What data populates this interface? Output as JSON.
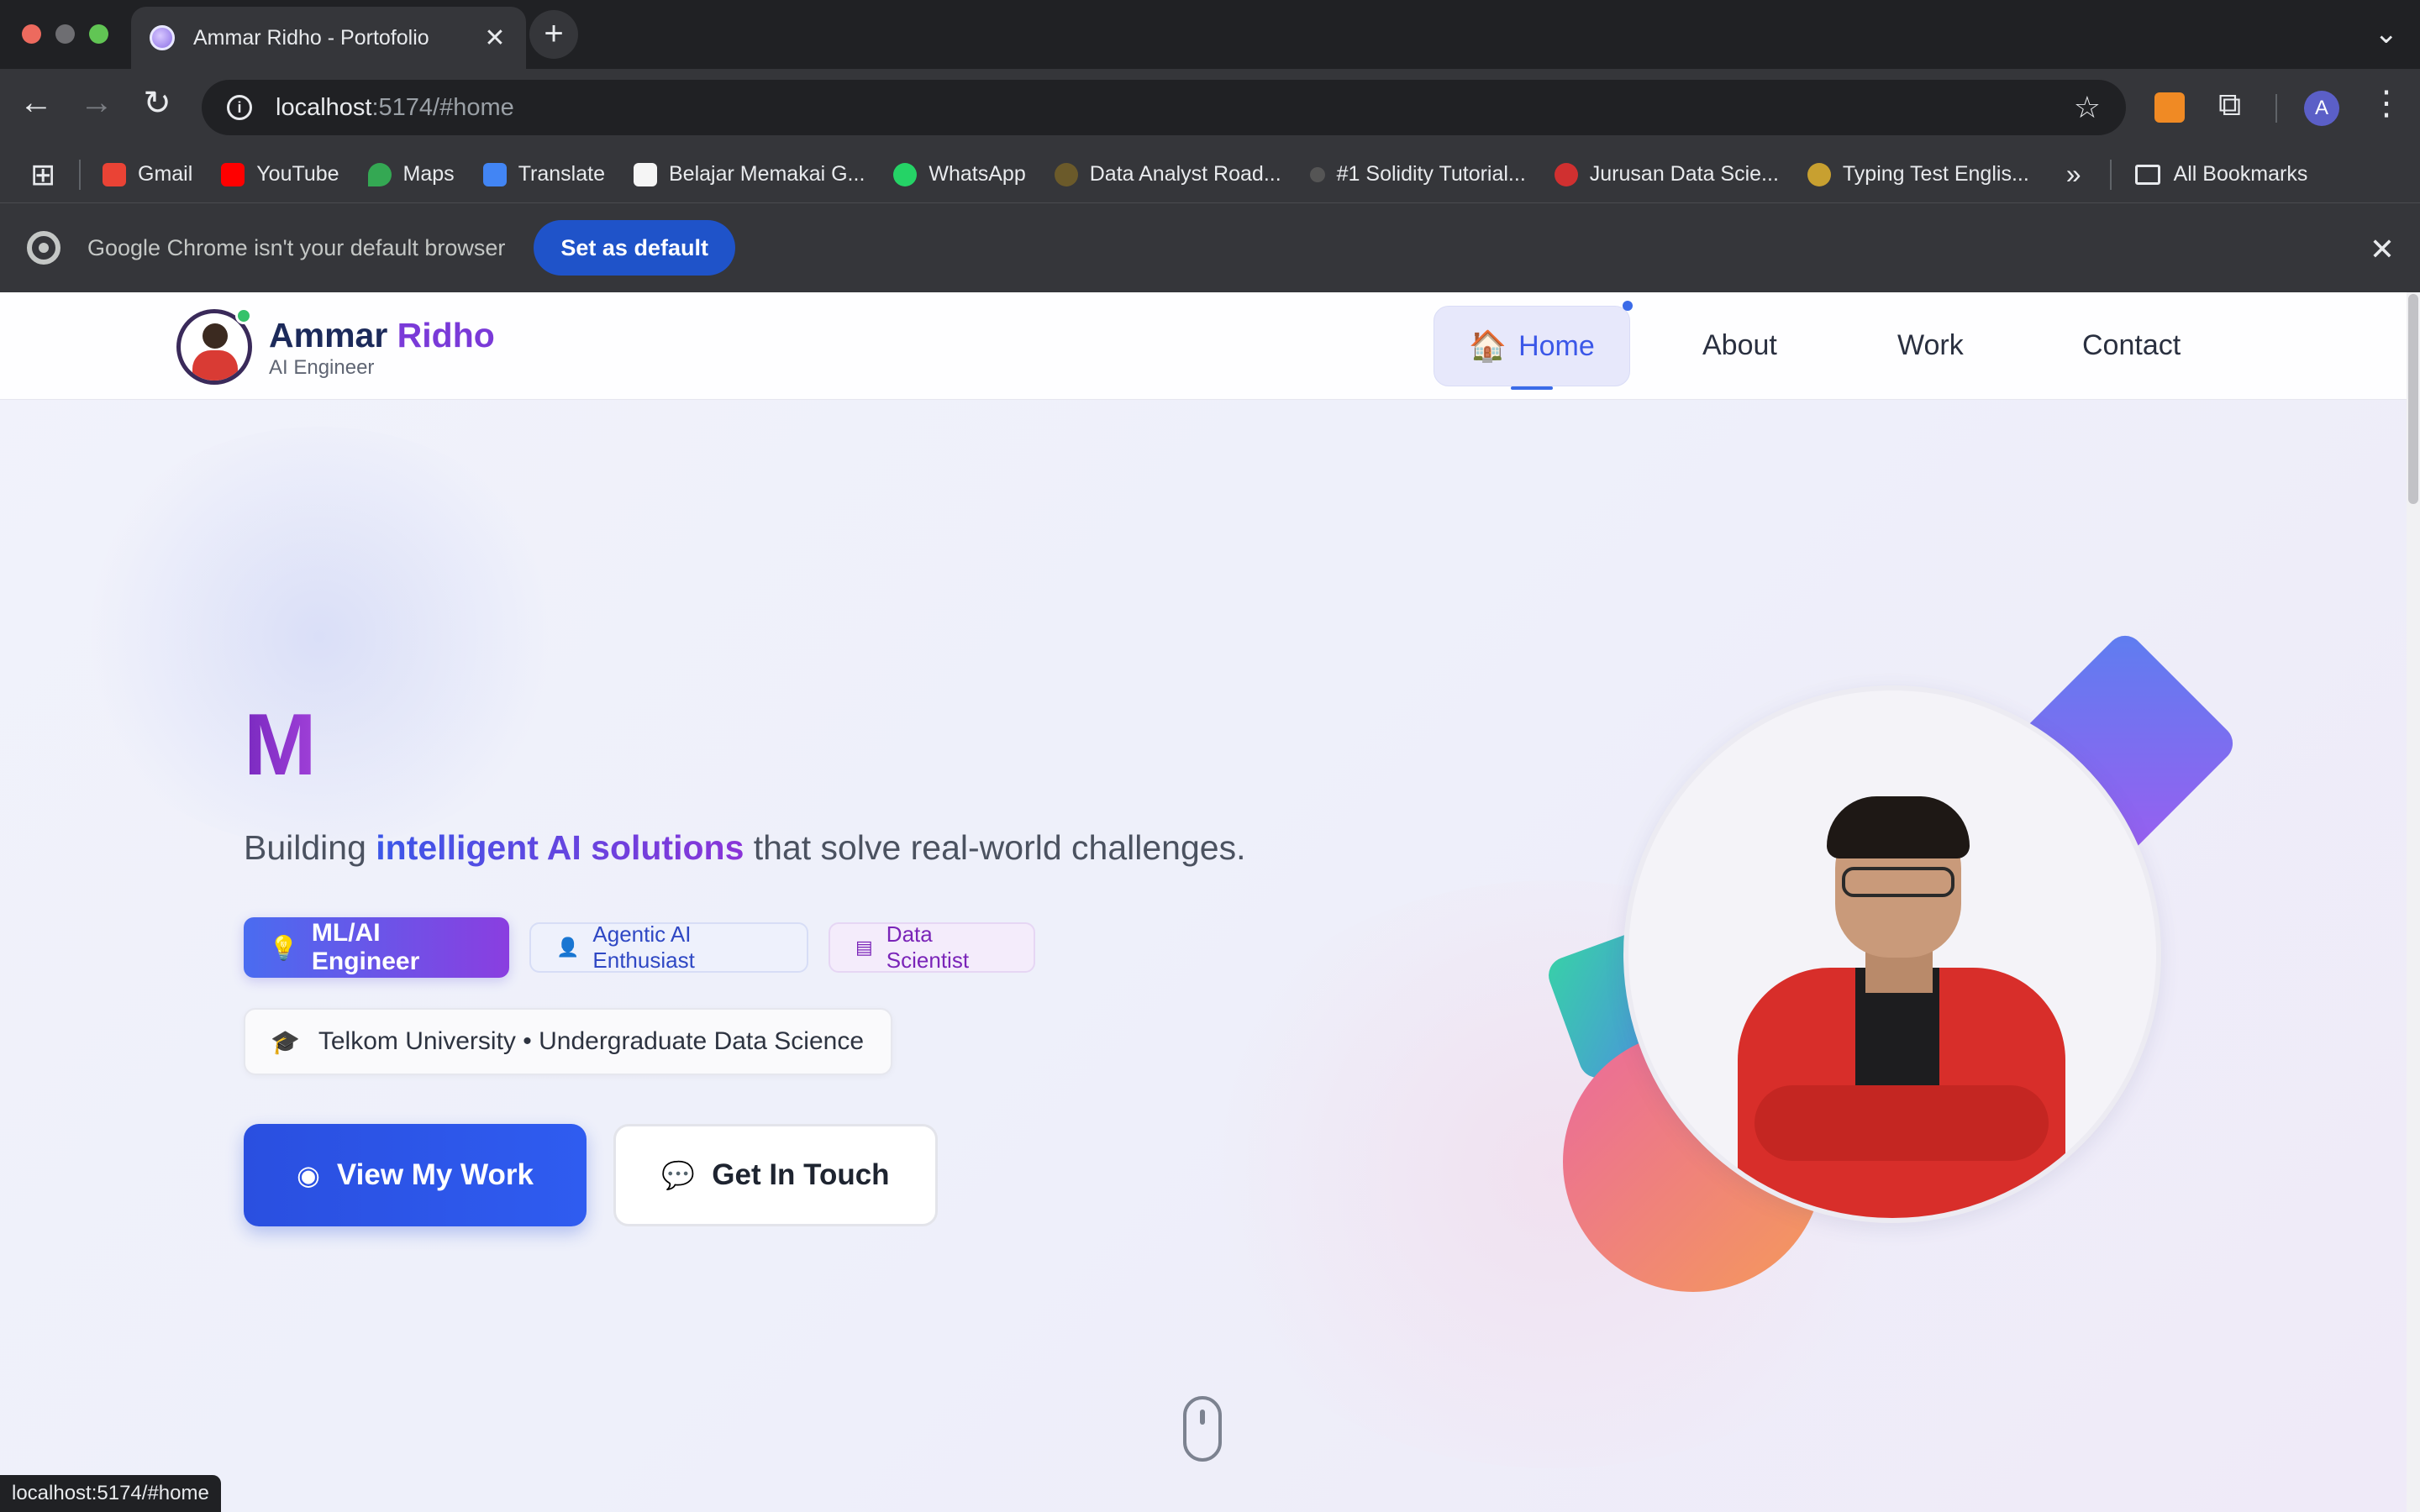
{
  "browser": {
    "tab_title": "Ammar Ridho - Portofolio",
    "new_tab": "+",
    "url_host": "localhost",
    "url_rest": ":5174/#home",
    "bookmarks": [
      {
        "label": "Gmail",
        "color": "#ea4335"
      },
      {
        "label": "YouTube",
        "color": "#ff0000"
      },
      {
        "label": "Maps",
        "color": "#34a853"
      },
      {
        "label": "Translate",
        "color": "#4285f4"
      },
      {
        "label": "Belajar Memakai G...",
        "color": "#111111"
      },
      {
        "label": "WhatsApp",
        "color": "#25d366"
      },
      {
        "label": "Data Analyst Road...",
        "color": "#c8a040"
      },
      {
        "label": "#1 Solidity Tutorial...",
        "color": "#555555"
      },
      {
        "label": "Jurusan Data Scie...",
        "color": "#d03030"
      },
      {
        "label": "Typing Test Englis...",
        "color": "#c8a030"
      }
    ],
    "all_bookmarks": "All Bookmarks",
    "profile_initial": "A",
    "infobar_text": "Google Chrome isn't your default browser",
    "infobar_button": "Set as default",
    "status_url": "localhost:5174/#home"
  },
  "site": {
    "brand_first": "Ammar",
    "brand_second": " Ridho",
    "brand_subtitle": "AI Engineer",
    "nav": {
      "home_emoji": "🏠",
      "home": "Home",
      "about": "About",
      "work": "Work",
      "contact": "Contact"
    },
    "hero": {
      "typing_text": "M",
      "tagline_before": "Building ",
      "tagline_highlight": "intelligent AI solutions",
      "tagline_after": " that solve real-world challenges.",
      "chips": {
        "ml": "ML/AI Engineer",
        "agentic": "Agentic AI Enthusiast",
        "ds": "Data Scientist"
      },
      "education": "Telkom University • Undergraduate Data Science",
      "primary_button": "View My Work",
      "secondary_button": "Get In Touch"
    }
  },
  "colors": {
    "accent_blue": "#2f5cf0",
    "accent_purple": "#8a3ee0",
    "online": "#35c26a"
  }
}
